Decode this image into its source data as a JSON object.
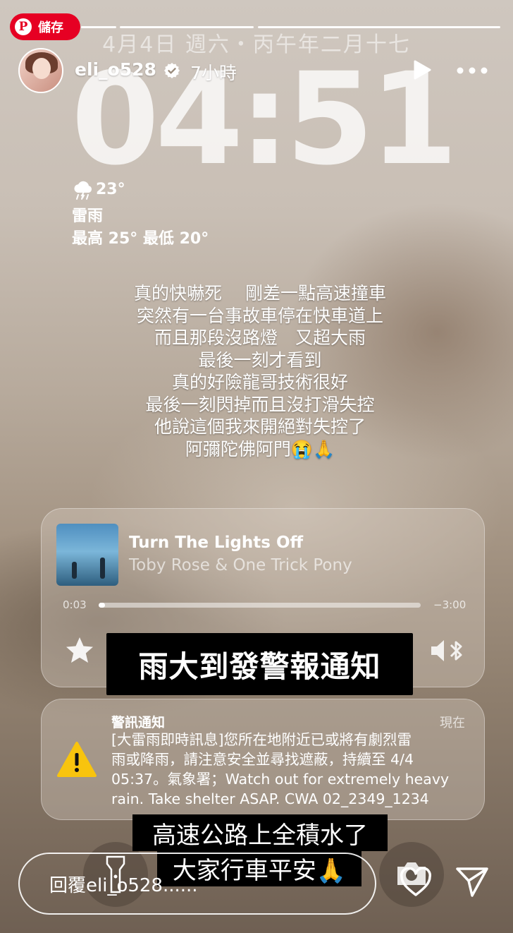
{
  "story": {
    "progress": {
      "segments": 3,
      "completed": 2,
      "current_fraction": 1.0
    }
  },
  "pinterest": {
    "save_label": "儲存",
    "logo": "P"
  },
  "header": {
    "username": "eli_o528",
    "verified_icon": "verified-badge-icon",
    "time_ago": "7小時",
    "play_icon": "play-icon",
    "more_icon": "more-options-icon"
  },
  "lock_screen": {
    "date": "4月4日 週六・丙午年二月十七",
    "time": "04:51",
    "weather": {
      "icon": "thunderstorm-icon",
      "temperature": "23°",
      "condition": "雷雨",
      "range": "最高 25° 最低 20°"
    }
  },
  "story_text": {
    "lines": [
      "真的快嚇死　 剛差一點高速撞車",
      "突然有一台事故車停在快車道上",
      "而且那段沒路燈　又超大雨",
      "最後一刻才看到",
      "真的好險龍哥技術很好",
      "最後一刻閃掉而且沒打滑失控",
      "他說這個我來開絕對失控了",
      "阿彌陀佛阿門😭🙏"
    ]
  },
  "music": {
    "song": "Turn The Lights Off",
    "artist": "Toby Rose & One Trick Pony",
    "elapsed": "0:03",
    "remaining": "−3:00",
    "progress_fraction": 0.016,
    "favorite_icon": "star-icon",
    "output_icon": "speaker-bluetooth-icon"
  },
  "captions": {
    "first": "雨大到發警報通知",
    "second": "高速公路上全積水了",
    "third": "大家行車平安🙏"
  },
  "alert": {
    "icon": "warning-icon",
    "title": "警訊通知",
    "time": "現在",
    "body_lines": [
      "[大雷雨即時訊息]您所在地附近已或將有劇烈雷",
      "雨或降雨，請注意安全並尋找遮蔽，持續至 4/4",
      "05:37。氣象署；Watch out for extremely heavy",
      "rain. Take shelter ASAP. CWA 02_2349_1234"
    ]
  },
  "footer": {
    "reply_placeholder": "回覆eli_o528......",
    "like_icon": "heart-icon",
    "share_icon": "send-icon",
    "flashlight_icon": "flashlight-icon",
    "camera_icon": "camera-icon"
  },
  "colors": {
    "pinterest_red": "#e60023",
    "caption_bg": "#000000",
    "text": "#ffffff"
  }
}
